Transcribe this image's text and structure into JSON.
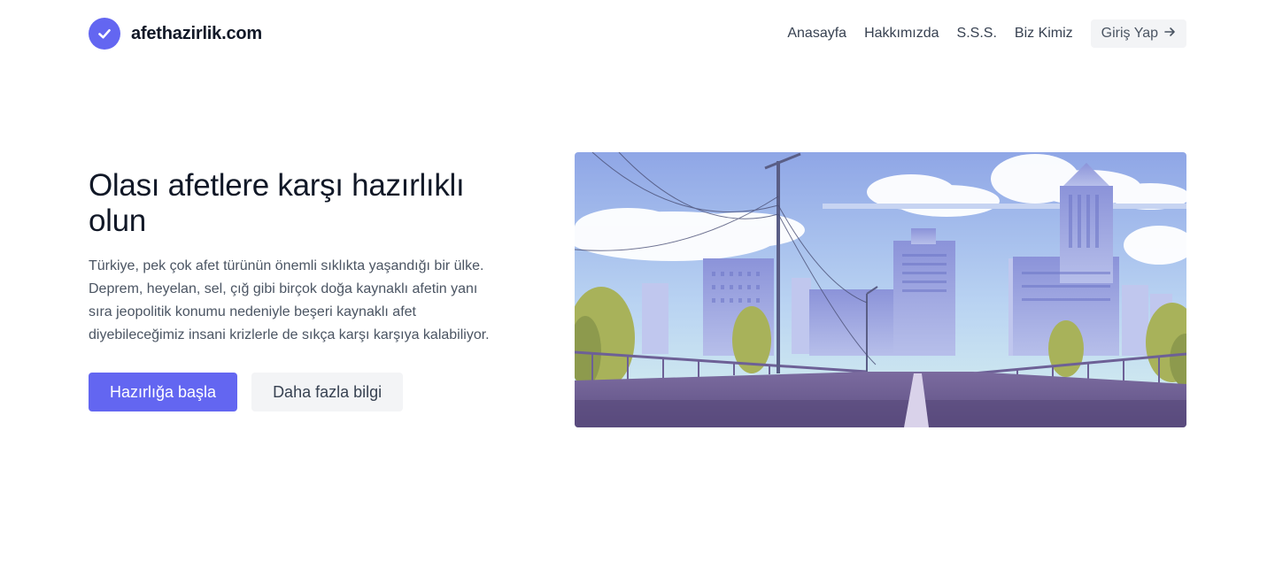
{
  "brand": {
    "name": "afethazirlik.com",
    "icon": "check-icon"
  },
  "nav": {
    "items": [
      {
        "label": "Anasayfa"
      },
      {
        "label": "Hakkımızda"
      },
      {
        "label": "S.S.S."
      },
      {
        "label": "Biz Kimiz"
      }
    ],
    "login_label": "Giriş Yap",
    "login_icon": "arrow-right-icon"
  },
  "hero": {
    "title": "Olası afetlere karşı hazırlıklı olun",
    "description": "Türkiye, pek çok afet türünün önemli sıklıkta yaşandığı bir ülke. Deprem, heyelan, sel, çığ gibi birçok doğa kaynaklı afetin yanı sıra jeopolitik konumu nedeniyle beşeri kaynaklı afet diyebileceğimiz insani krizlerle de sıkça karşı karşıya kalabiliyor.",
    "primary_button": "Hazırlığa başla",
    "secondary_button": "Daha fazla bilgi"
  },
  "colors": {
    "accent": "#6366f1",
    "button_secondary_bg": "#f3f4f6",
    "text_primary": "#111827",
    "text_secondary": "#4b5563"
  }
}
